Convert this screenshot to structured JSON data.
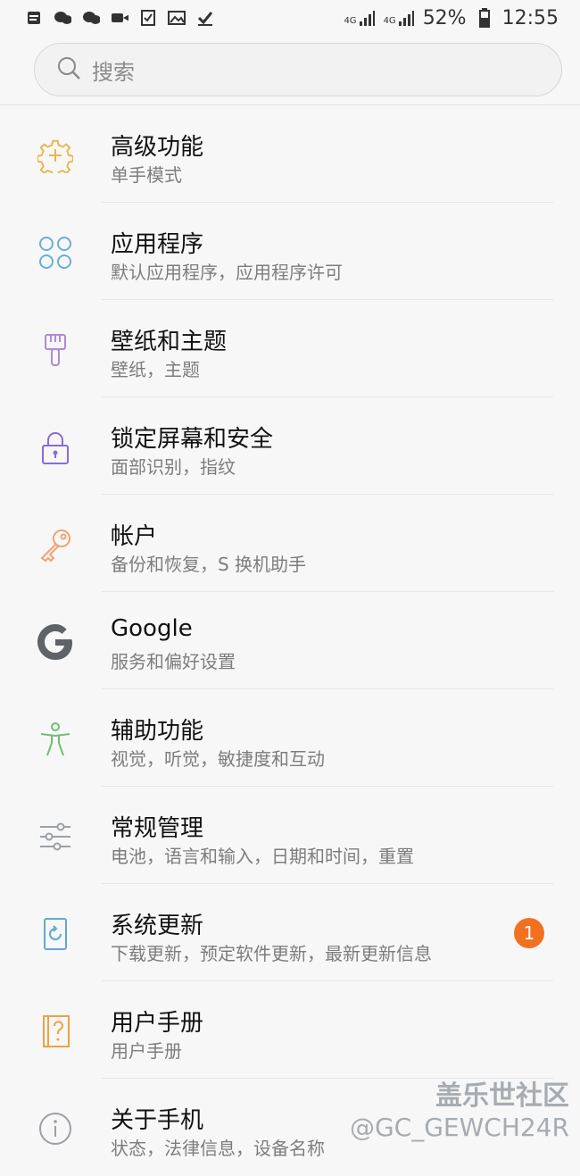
{
  "status_bar": {
    "network_label_1": "4G",
    "network_label_2": "4G",
    "battery": "52%",
    "time": "12:55"
  },
  "search": {
    "placeholder": "搜索"
  },
  "settings": [
    {
      "title": "高级功能",
      "subtitle": "单手模式",
      "icon": "advanced-features-icon"
    },
    {
      "title": "应用程序",
      "subtitle": "默认应用程序，应用程序许可",
      "icon": "apps-icon"
    },
    {
      "title": "壁纸和主题",
      "subtitle": "壁纸，主题",
      "icon": "wallpaper-theme-icon"
    },
    {
      "title": "锁定屏幕和安全",
      "subtitle": "面部识别，指纹",
      "icon": "lock-icon"
    },
    {
      "title": "帐户",
      "subtitle": "备份和恢复，S 换机助手",
      "icon": "key-icon"
    },
    {
      "title": "Google",
      "subtitle": "服务和偏好设置",
      "icon": "google-icon"
    },
    {
      "title": "辅助功能",
      "subtitle": "视觉，听觉，敏捷度和互动",
      "icon": "accessibility-icon"
    },
    {
      "title": "常规管理",
      "subtitle": "电池，语言和输入，日期和时间，重置",
      "icon": "sliders-icon"
    },
    {
      "title": "系统更新",
      "subtitle": "下载更新，预定软件更新，最新更新信息",
      "icon": "system-update-icon",
      "badge": "1"
    },
    {
      "title": "用户手册",
      "subtitle": "用户手册",
      "icon": "user-manual-icon"
    },
    {
      "title": "关于手机",
      "subtitle": "状态，法律信息，设备名称",
      "icon": "info-icon"
    }
  ],
  "watermark": {
    "line1": "盖乐世社区",
    "line2": "@GC_GEWCH24R"
  },
  "colors": {
    "advanced": "#e8b64a",
    "apps": "#6aaed6",
    "wallpaper": "#b18ad0",
    "lock": "#8a6bd8",
    "key": "#f0a36e",
    "google": "#5f6368",
    "accessibility": "#6fbf73",
    "sliders": "#9aa0a6",
    "update": "#5fa9d6",
    "manual": "#f0a040",
    "info": "#9aa0a6",
    "badge": "#f37021"
  }
}
